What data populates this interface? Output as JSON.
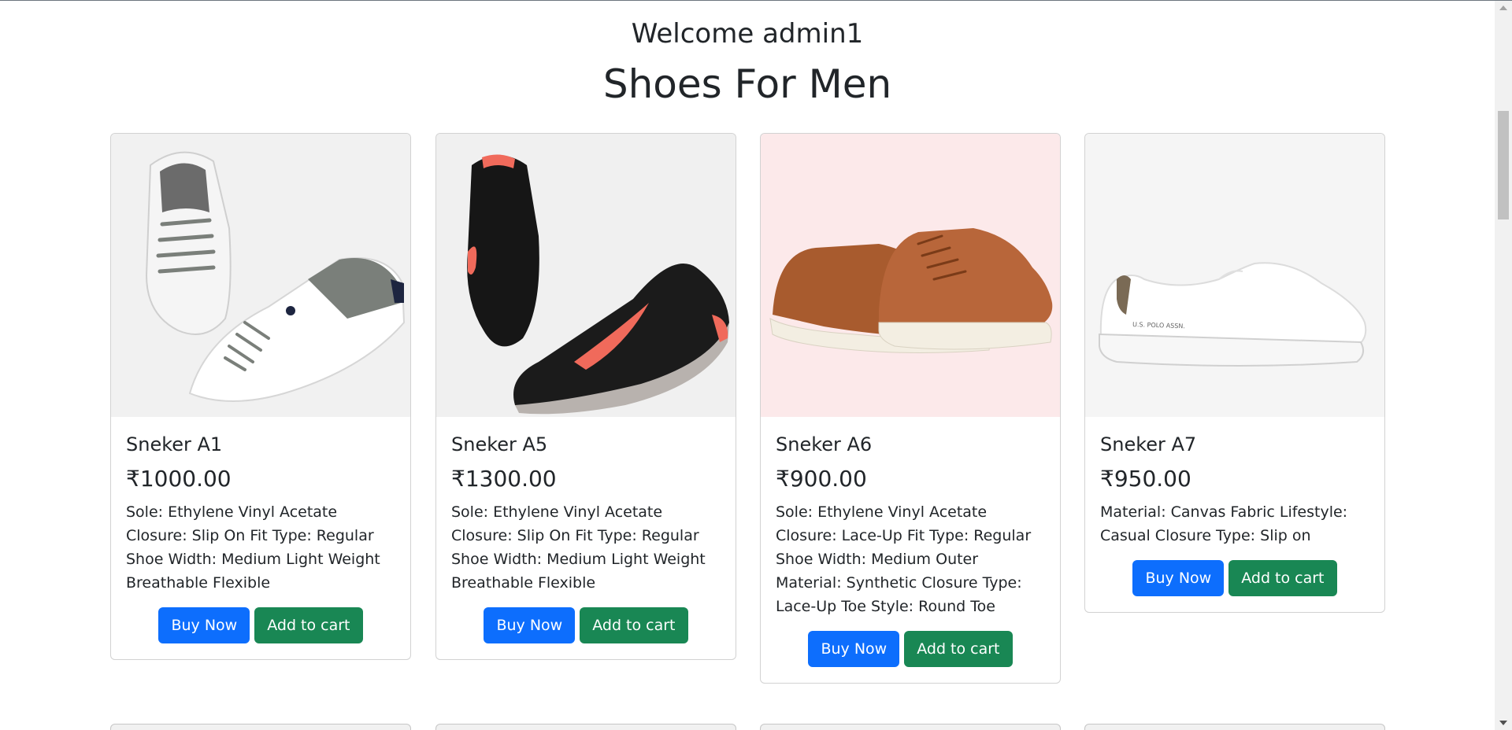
{
  "header": {
    "welcome": "Welcome admin1",
    "title": "Shoes For Men"
  },
  "products": [
    {
      "name": "Sneker A1",
      "price": "₹1000.00",
      "description": "Sole: Ethylene Vinyl Acetate Closure: Slip On Fit Type: Regular Shoe Width: Medium Light Weight Breathable Flexible",
      "image": "white-grey-slip-on-sneakers"
    },
    {
      "name": "Sneker A5",
      "price": "₹1300.00",
      "description": "Sole: Ethylene Vinyl Acetate Closure: Slip On Fit Type: Regular Shoe Width: Medium Light Weight Breathable Flexible",
      "image": "black-running-shoes"
    },
    {
      "name": "Sneker A6",
      "price": "₹900.00",
      "description": "Sole: Ethylene Vinyl Acetate Closure: Lace-Up Fit Type: Regular Shoe Width: Medium Outer Material: Synthetic Closure Type: Lace-Up Toe Style: Round Toe",
      "image": "brown-leather-sneakers"
    },
    {
      "name": "Sneker A7",
      "price": "₹950.00",
      "description": "Material: Canvas Fabric Lifestyle: Casual Closure Type: Slip on",
      "image": "white-knit-slip-on-sneaker"
    }
  ],
  "buttons": {
    "buy": "Buy Now",
    "cart": "Add to cart"
  },
  "colors": {
    "primary": "#0d6efd",
    "success": "#198754",
    "text": "#212529"
  }
}
